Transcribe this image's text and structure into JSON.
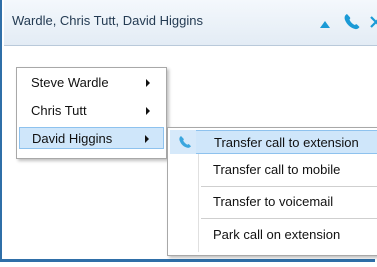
{
  "window": {
    "title": "Wardle, Chris Tutt, David Higgins",
    "icons": [
      "up-arrow-icon",
      "phone-icon",
      "close-icon"
    ],
    "accent_color": "#2f6fa8"
  },
  "menu": {
    "items": [
      {
        "label": "Steve Wardle",
        "has_submenu": true
      },
      {
        "label": "Chris Tutt",
        "has_submenu": true
      },
      {
        "label": "David Higgins",
        "has_submenu": true,
        "selected": true
      }
    ]
  },
  "submenu": {
    "items": [
      {
        "label": "Transfer call to extension",
        "icon": "phone-icon",
        "selected": true
      },
      {
        "label": "Transfer call to mobile"
      },
      {
        "label": "Transfer to voicemail"
      },
      {
        "label": "Park call on extension"
      }
    ],
    "highlight_color": "#cfe6fa"
  }
}
